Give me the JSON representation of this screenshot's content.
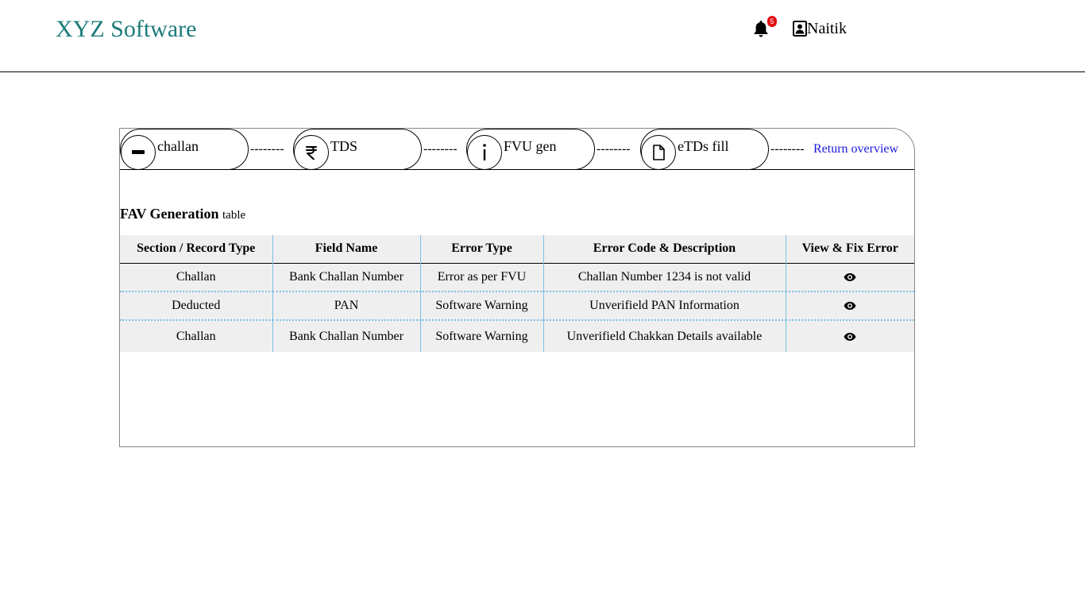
{
  "app": {
    "title": "XYZ Software"
  },
  "header": {
    "notification_count": "5",
    "user_name": "Naitik"
  },
  "steps": [
    {
      "label": "challan",
      "icon": "minus-icon"
    },
    {
      "label": "TDS",
      "icon": "rupee-icon"
    },
    {
      "label": "FVU gen",
      "icon": "info-icon"
    },
    {
      "label": "eTDs fill",
      "icon": "document-icon"
    }
  ],
  "connector_text": "--------",
  "return_link": "Return overview",
  "table": {
    "title_bold": "FAV Generation",
    "title_small": "table",
    "columns": [
      "Section / Record Type",
      "Field Name",
      "Error Type",
      "Error Code & Description",
      "View & Fix Error"
    ],
    "rows": [
      [
        "Challan",
        "Bank Challan Number",
        "Error as per FVU",
        "Challan Number 1234 is not valid"
      ],
      [
        "Deducted",
        "PAN",
        "Software Warning",
        "Unverifield PAN Information"
      ],
      [
        "Challan",
        "Bank Challan Number",
        "Software Warning",
        "Unverifield Chakkan Details available"
      ]
    ]
  },
  "colors": {
    "brand": "#1c7a7a",
    "badge": "#e21010",
    "link": "#1a1ad6",
    "table_divider": "#7cc0e6",
    "row_bg": "#efefef"
  }
}
